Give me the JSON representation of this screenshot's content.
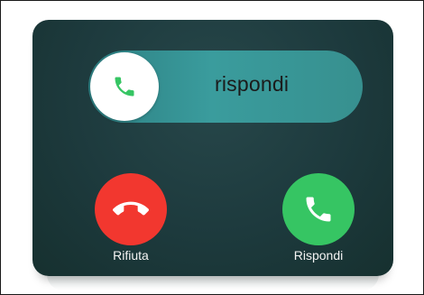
{
  "incoming_call": {
    "slider": {
      "label": "rispondi",
      "knob_icon": "phone-icon"
    },
    "decline_button": {
      "label": "Rifiuta",
      "icon": "phone-hangup-icon",
      "color": "#f2372f"
    },
    "accept_button": {
      "label": "Rispondi",
      "icon": "phone-icon",
      "color": "#36c563"
    },
    "accent_color": "#3a9c9d"
  }
}
